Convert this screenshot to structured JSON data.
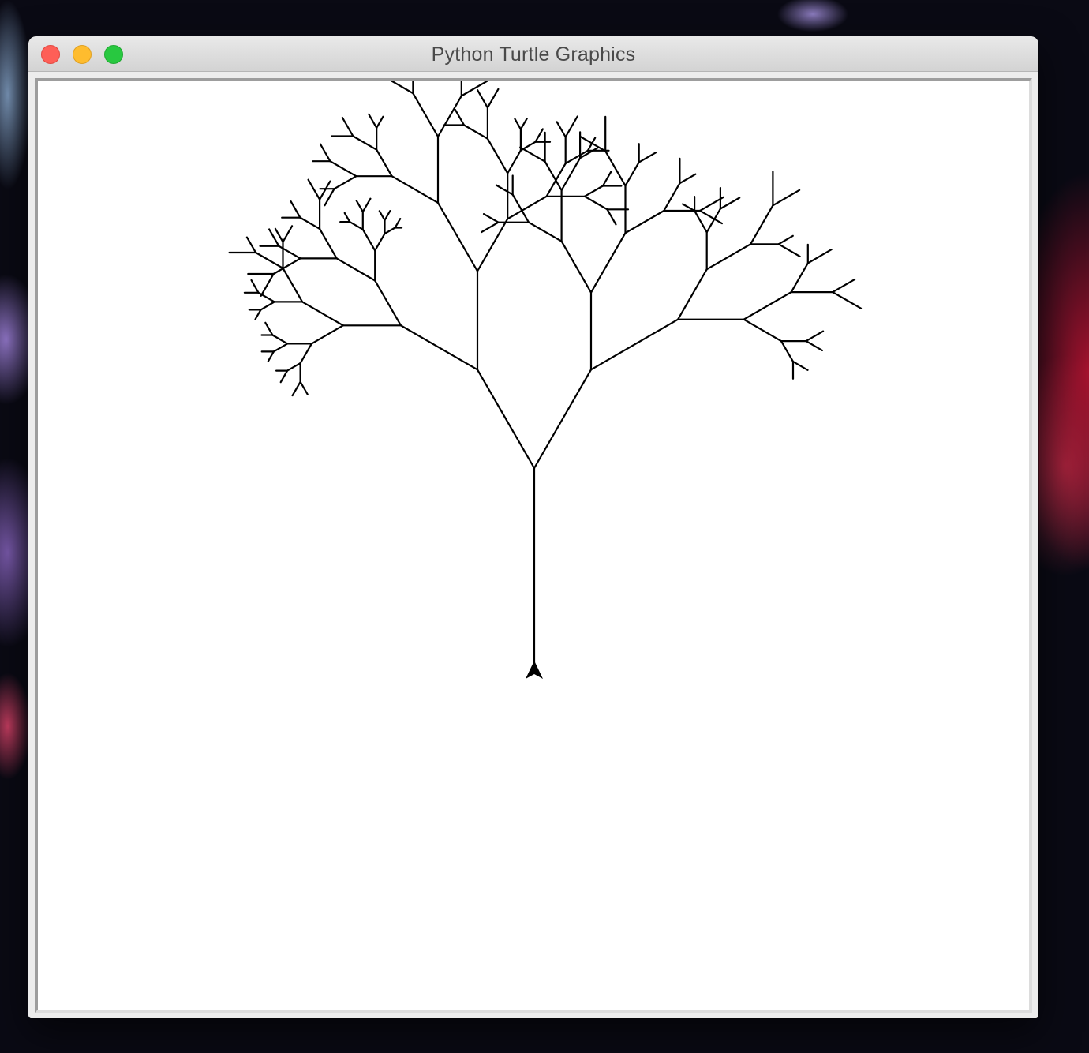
{
  "window": {
    "title": "Python Turtle Graphics",
    "controls": {
      "close": "close-icon",
      "minimize": "minimize-icon",
      "zoom": "zoom-icon"
    },
    "colors": {
      "close": "#fe5f57",
      "minimize": "#febc2e",
      "zoom": "#28c840"
    }
  },
  "canvas": {
    "background": "#ffffff",
    "pen_color": "#000000",
    "turtle_shape": "arrow",
    "turtle_heading": "up",
    "drawing": "fractal-tree"
  }
}
